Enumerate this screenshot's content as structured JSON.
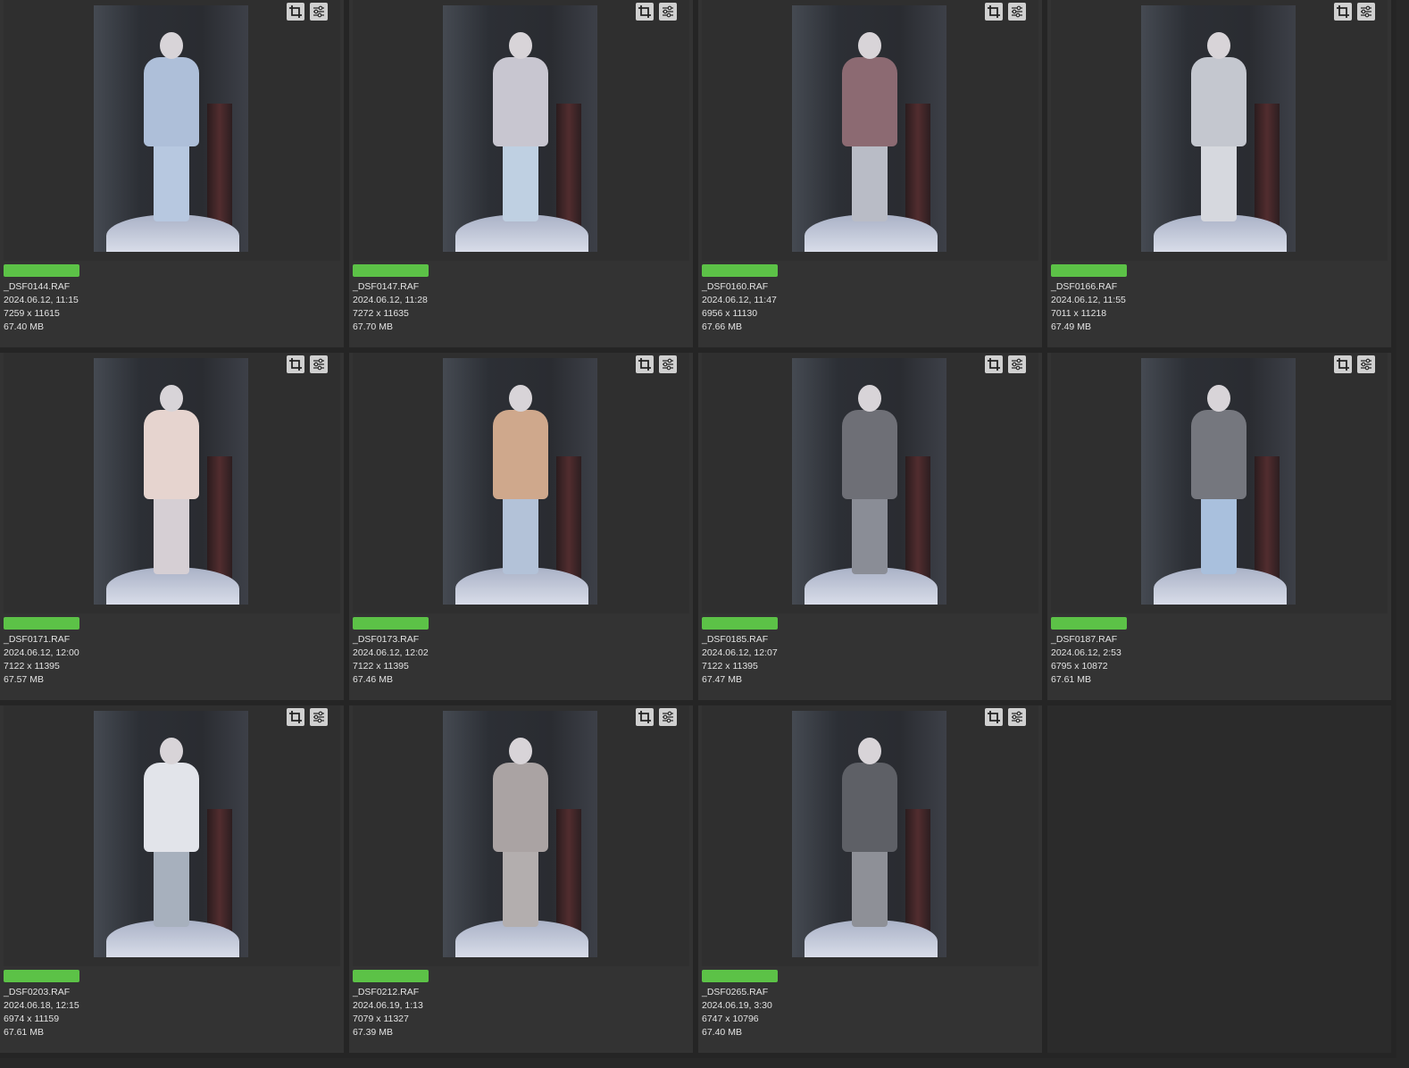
{
  "label_color": "#5cc247",
  "cells": [
    {
      "name": "_DSF0144.RAF",
      "date": "2024.06.12, 11:15",
      "dims": "7259 x 11615",
      "size": "67.40 MB",
      "body": "#aebfd9",
      "legs": "#b7c8e0"
    },
    {
      "name": "_DSF0147.RAF",
      "date": "2024.06.12, 11:28",
      "dims": "7272 x 11635",
      "size": "67.70 MB",
      "body": "#c8c6d0",
      "legs": "#bfd0e2"
    },
    {
      "name": "_DSF0160.RAF",
      "date": "2024.06.12, 11:47",
      "dims": "6956 x 11130",
      "size": "67.66 MB",
      "body": "#8c6a72",
      "legs": "#b9bcc6"
    },
    {
      "name": "_DSF0166.RAF",
      "date": "2024.06.12, 11:55",
      "dims": "7011 x 11218",
      "size": "67.49 MB",
      "body": "#c4c7cf",
      "legs": "#d6d8de"
    },
    {
      "name": "_DSF0171.RAF",
      "date": "2024.06.12, 12:00",
      "dims": "7122 x 11395",
      "size": "67.57 MB",
      "body": "#e6d4cf",
      "legs": "#d6cfd4"
    },
    {
      "name": "_DSF0173.RAF",
      "date": "2024.06.12, 12:02",
      "dims": "7122 x 11395",
      "size": "67.46 MB",
      "body": "#cfa88c",
      "legs": "#b3c2d8"
    },
    {
      "name": "_DSF0185.RAF",
      "date": "2024.06.12, 12:07",
      "dims": "7122 x 11395",
      "size": "67.47 MB",
      "body": "#6e6f76",
      "legs": "#8a8d96"
    },
    {
      "name": "_DSF0187.RAF",
      "date": "2024.06.12, 2:53",
      "dims": "6795 x 10872",
      "size": "67.61 MB",
      "body": "#75777e",
      "legs": "#a9c0dd"
    },
    {
      "name": "_DSF0203.RAF",
      "date": "2024.06.18, 12:15",
      "dims": "6974 x 11159",
      "size": "67.61 MB",
      "body": "#e2e4ea",
      "legs": "#a7b0bd"
    },
    {
      "name": "_DSF0212.RAF",
      "date": "2024.06.19, 1:13",
      "dims": "7079 x 11327",
      "size": "67.39 MB",
      "body": "#aaa3a3",
      "legs": "#b3aeae"
    },
    {
      "name": "_DSF0265.RAF",
      "date": "2024.06.19, 3:30",
      "dims": "6747 x 10796",
      "size": "67.40 MB",
      "body": "#5e6066",
      "legs": "#8e9097"
    }
  ],
  "icons": [
    "crop-icon",
    "adjustments-icon"
  ]
}
